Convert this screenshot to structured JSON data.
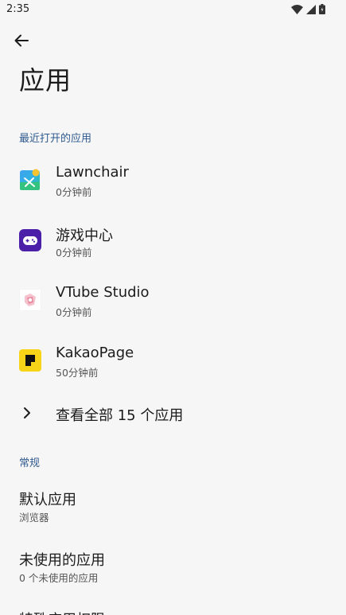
{
  "status_bar": {
    "time": "2:35"
  },
  "header": {
    "title": "应用"
  },
  "recent": {
    "section_label": "最近打开的应用",
    "apps": [
      {
        "name": "Lawnchair",
        "time": "0分钟前",
        "icon": "lawnchair-icon"
      },
      {
        "name": "游戏中心",
        "time": "0分钟前",
        "icon": "gamepad-icon"
      },
      {
        "name": "VTube Studio",
        "time": "0分钟前",
        "icon": "vtube-icon"
      },
      {
        "name": "KakaoPage",
        "time": "50分钟前",
        "icon": "kakaopage-icon"
      }
    ],
    "see_all_label": "查看全部 15 个应用"
  },
  "general": {
    "section_label": "常规",
    "items": [
      {
        "title": "默认应用",
        "subtitle": "浏览器"
      },
      {
        "title": "未使用的应用",
        "subtitle": "0 个未使用的应用"
      },
      {
        "title": "特殊应用权限",
        "subtitle": ""
      }
    ]
  },
  "colors": {
    "background": "#f6f6f6",
    "section_label": "#2f5a8f",
    "gamepad_bg": "#4b1fa8",
    "kakao_bg": "#f7d417"
  }
}
